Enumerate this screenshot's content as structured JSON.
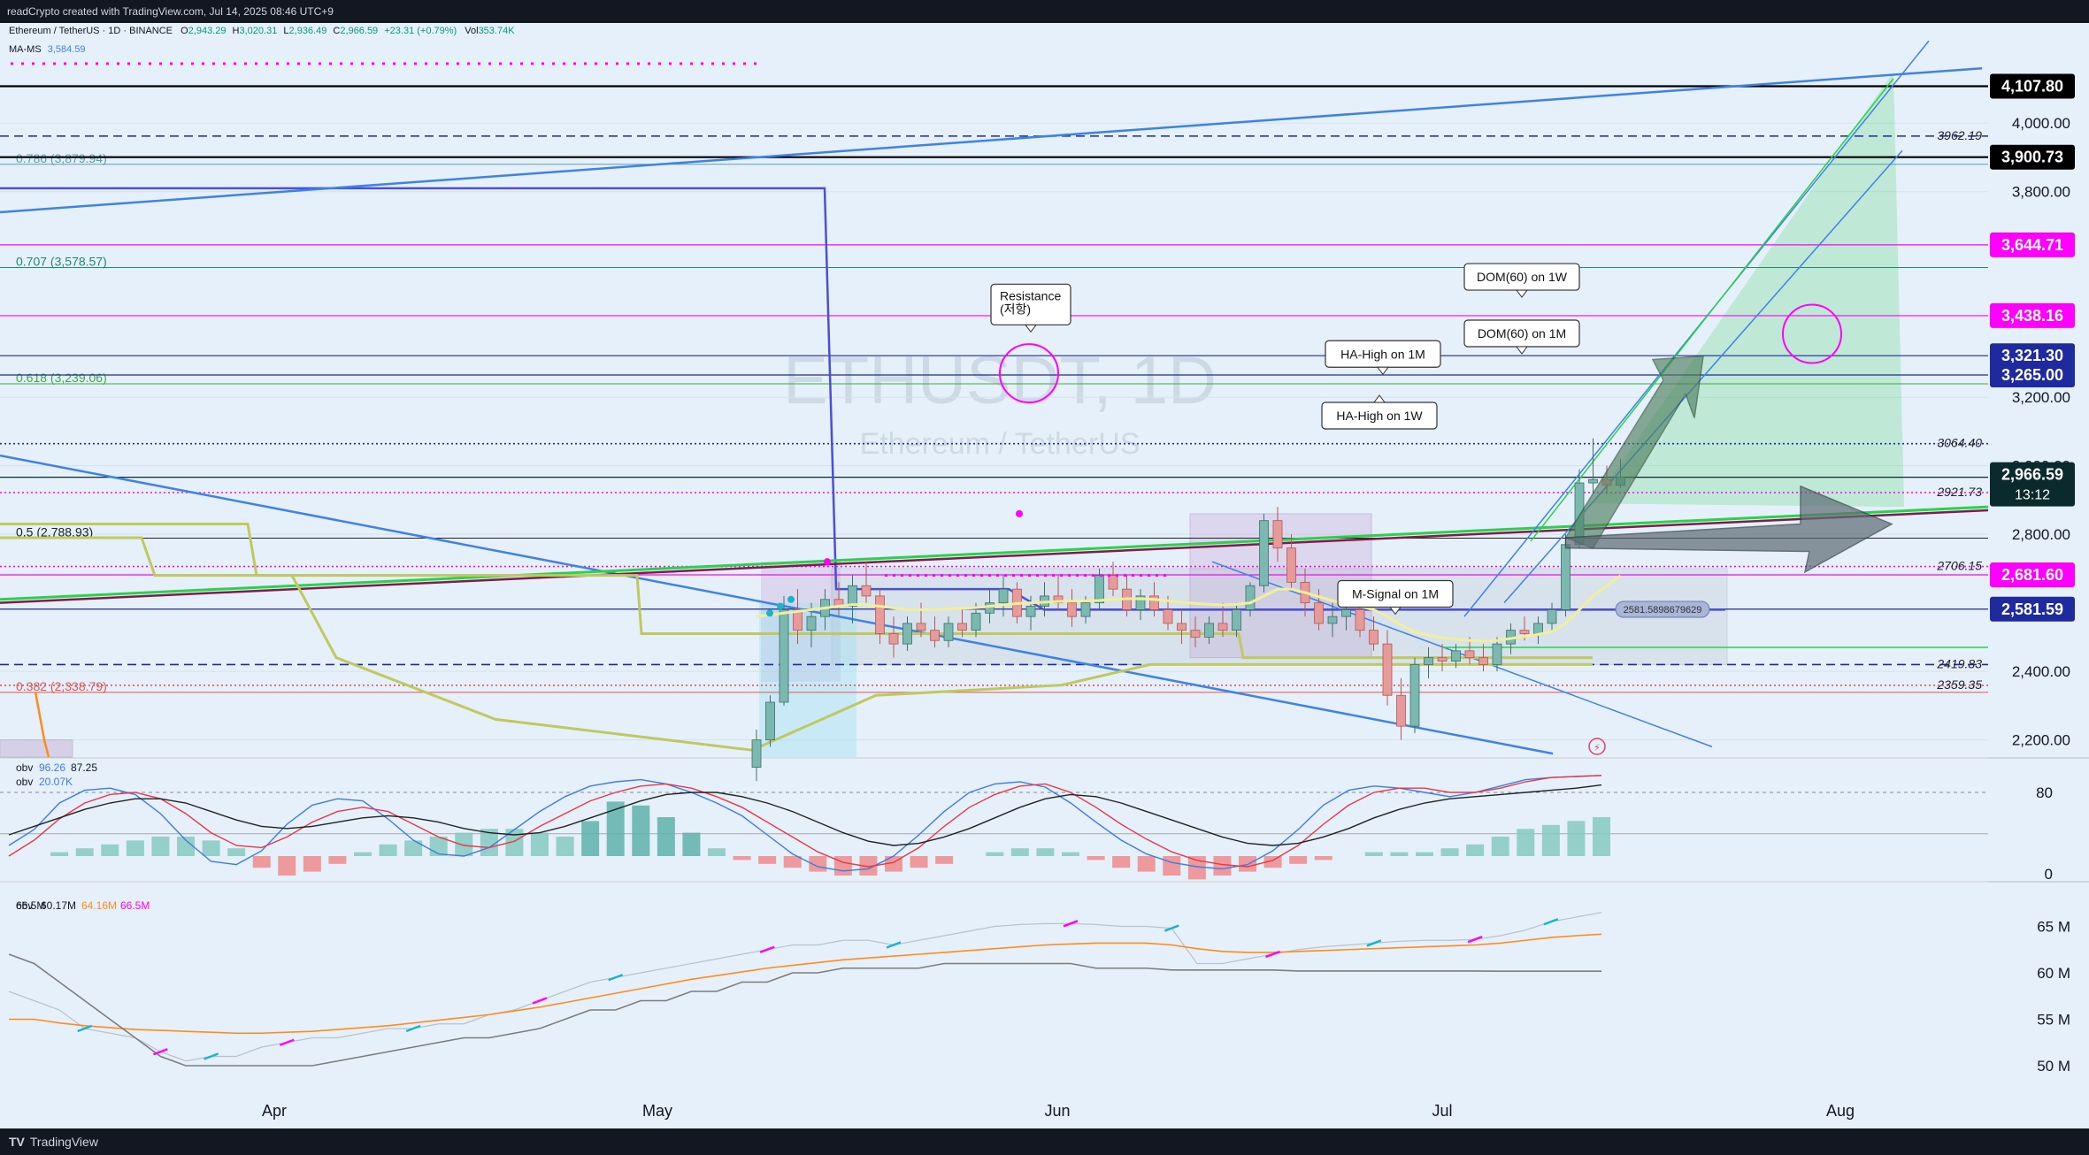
{
  "header": {
    "credit": "readCrypto created with TradingView.com, Jul 14, 2025 08:46 UTC+9"
  },
  "legend": {
    "symbol_line": "Ethereum / TetherUS · 1D · BINANCE",
    "open_label": "O",
    "open": "2,943.29",
    "high_label": "H",
    "high": "3,020.31",
    "low_label": "L",
    "low": "2,936.49",
    "close_label": "C",
    "close": "2,966.59",
    "change": "+23.31 (+0.79%)",
    "vol_label": "Vol",
    "volume": "353.74K",
    "ma_line_prefix": "MA-MS",
    "ma_line_value": "3,584.59"
  },
  "watermark": {
    "symbol": "ETHUSDT, 1D",
    "name": "Ethereum / TetherUS"
  },
  "colors": {
    "background": "#e5f0fa",
    "up_candle": "#7ab8b0",
    "down_candle": "#e69a9a",
    "blue_line": "#3f82e6",
    "navy_line": "#1f2a9e",
    "magenta": "#ff00ff",
    "green_line": "#2bd14a",
    "olive": "#c0c860",
    "fib_text": "#5a9fb3",
    "price_tag": "#0b2a2e"
  },
  "chart_data": [
    {
      "type": "line",
      "title": "ETHUSDT, 1D",
      "subtitle": "Ethereum / TetherUS",
      "x_axis": {
        "ticks": [
          "Apr",
          "May",
          "Jun",
          "Jul",
          "Aug"
        ]
      },
      "y_axis": {
        "range": [
          2150,
          4220
        ],
        "ticks": [
          "2,200.00",
          "2,400.00",
          "2,800.00",
          "3,000.00",
          "3,200.00",
          "3,800.00",
          "4,000.00"
        ]
      },
      "price_tags": [
        {
          "label": "4,107.80",
          "price": 4107.8,
          "style": "black"
        },
        {
          "label": "3,900.73",
          "price": 3900.73,
          "style": "black"
        },
        {
          "label": "3,644.71",
          "price": 3644.71,
          "style": "magenta"
        },
        {
          "label": "3,438.16",
          "price": 3438.16,
          "style": "magenta"
        },
        {
          "label": "3,321.30",
          "price": 3321.3,
          "style": "navy"
        },
        {
          "label": "3,265.00",
          "price": 3265.0,
          "style": "navy"
        },
        {
          "label": "2,966.59",
          "sublabel": "13:12",
          "price": 2966.59,
          "style": "dark"
        },
        {
          "label": "2,681.60",
          "price": 2681.6,
          "style": "magenta"
        },
        {
          "label": "2,581.59",
          "price": 2581.59,
          "style": "navy"
        }
      ],
      "level_labels": [
        {
          "label": "3962.19",
          "price": 3962.19
        },
        {
          "label": "3064.40",
          "price": 3064.4
        },
        {
          "label": "2921.73",
          "price": 2921.73
        },
        {
          "label": "2706.15",
          "price": 2706.15
        },
        {
          "label": "2419.83",
          "price": 2419.83
        },
        {
          "label": "2359.35",
          "price": 2359.35
        }
      ],
      "fib_levels": [
        {
          "label": "0.786 (3,879.94)",
          "price": 3879.94
        },
        {
          "label": "0.707 (3,578.57)",
          "price": 3578.57
        },
        {
          "label": "0.618 (3,239.06)",
          "price": 3239.06
        },
        {
          "label": "0.5 (2,788.93)",
          "price": 2788.93
        },
        {
          "label": "0.382 (2,338.79)",
          "price": 2338.79
        }
      ],
      "callouts": [
        {
          "text": "Resistance\n(저항)"
        },
        {
          "text": "DOM(60) on 1W"
        },
        {
          "text": "DOM(60) on 1M"
        },
        {
          "text": "HA-High on 1M"
        },
        {
          "text": "HA-High on 1W"
        },
        {
          "text": "M-Signal on 1M"
        }
      ],
      "box_label": "2581.5898679629",
      "candles": [
        [
          2120,
          2230,
          2080,
          2200
        ],
        [
          2200,
          2330,
          2180,
          2310
        ],
        [
          2310,
          2620,
          2300,
          2580
        ],
        [
          2580,
          2640,
          2480,
          2520
        ],
        [
          2520,
          2600,
          2470,
          2560
        ],
        [
          2560,
          2640,
          2520,
          2610
        ],
        [
          2610,
          2660,
          2560,
          2590
        ],
        [
          2590,
          2680,
          2540,
          2650
        ],
        [
          2650,
          2720,
          2600,
          2620
        ],
        [
          2620,
          2640,
          2480,
          2510
        ],
        [
          2510,
          2560,
          2440,
          2480
        ],
        [
          2480,
          2560,
          2460,
          2540
        ],
        [
          2540,
          2600,
          2500,
          2520
        ],
        [
          2520,
          2560,
          2470,
          2490
        ],
        [
          2490,
          2560,
          2470,
          2540
        ],
        [
          2540,
          2580,
          2500,
          2520
        ],
        [
          2520,
          2600,
          2500,
          2570
        ],
        [
          2570,
          2640,
          2540,
          2600
        ],
        [
          2600,
          2680,
          2560,
          2640
        ],
        [
          2640,
          2660,
          2540,
          2560
        ],
        [
          2560,
          2620,
          2520,
          2590
        ],
        [
          2590,
          2660,
          2560,
          2620
        ],
        [
          2620,
          2680,
          2580,
          2600
        ],
        [
          2600,
          2640,
          2530,
          2560
        ],
        [
          2560,
          2620,
          2540,
          2600
        ],
        [
          2600,
          2700,
          2580,
          2680
        ],
        [
          2680,
          2720,
          2620,
          2640
        ],
        [
          2640,
          2680,
          2560,
          2580
        ],
        [
          2580,
          2640,
          2550,
          2620
        ],
        [
          2620,
          2660,
          2560,
          2580
        ],
        [
          2580,
          2620,
          2520,
          2540
        ],
        [
          2540,
          2580,
          2480,
          2520
        ],
        [
          2520,
          2560,
          2470,
          2500
        ],
        [
          2500,
          2560,
          2480,
          2540
        ],
        [
          2540,
          2600,
          2500,
          2520
        ],
        [
          2520,
          2600,
          2500,
          2580
        ],
        [
          2580,
          2660,
          2560,
          2650
        ],
        [
          2650,
          2860,
          2630,
          2840
        ],
        [
          2840,
          2880,
          2720,
          2760
        ],
        [
          2760,
          2800,
          2640,
          2660
        ],
        [
          2660,
          2700,
          2560,
          2600
        ],
        [
          2600,
          2640,
          2520,
          2540
        ],
        [
          2540,
          2600,
          2500,
          2560
        ],
        [
          2560,
          2620,
          2520,
          2580
        ],
        [
          2580,
          2620,
          2500,
          2520
        ],
        [
          2520,
          2560,
          2460,
          2480
        ],
        [
          2480,
          2520,
          2300,
          2330
        ],
        [
          2330,
          2380,
          2200,
          2240
        ],
        [
          2240,
          2440,
          2220,
          2420
        ],
        [
          2420,
          2470,
          2380,
          2440
        ],
        [
          2440,
          2480,
          2400,
          2430
        ],
        [
          2430,
          2480,
          2410,
          2460
        ],
        [
          2460,
          2500,
          2420,
          2440
        ],
        [
          2440,
          2480,
          2400,
          2420
        ],
        [
          2420,
          2500,
          2400,
          2480
        ],
        [
          2480,
          2540,
          2450,
          2520
        ],
        [
          2520,
          2560,
          2490,
          2510
        ],
        [
          2510,
          2560,
          2480,
          2540
        ],
        [
          2540,
          2600,
          2520,
          2580
        ],
        [
          2580,
          2800,
          2560,
          2770
        ],
        [
          2770,
          2990,
          2760,
          2950
        ],
        [
          2950,
          3080,
          2920,
          2960
        ],
        [
          2960,
          3000,
          2920,
          2943
        ],
        [
          2943,
          3020,
          2936,
          2967
        ]
      ],
      "series": [
        {
          "name": "M-Signal on 1D",
          "color": "#f7f5c0",
          "values": [
            2560,
            2565,
            2570,
            2575,
            2580,
            2585,
            2590,
            2595,
            2595,
            2590,
            2585,
            2580,
            2580,
            2580,
            2582,
            2584,
            2586,
            2590,
            2594,
            2598,
            2600,
            2602,
            2604,
            2605,
            2606,
            2607,
            2610,
            2612,
            2612,
            2610,
            2606,
            2602,
            2598,
            2596,
            2594,
            2596,
            2600,
            2620,
            2640,
            2640,
            2630,
            2618,
            2606,
            2598,
            2590,
            2580,
            2560,
            2535,
            2515,
            2505,
            2498,
            2494,
            2490,
            2488,
            2490,
            2496,
            2502,
            2508,
            2516,
            2540,
            2580,
            2620,
            2650,
            2680
          ]
        }
      ]
    },
    {
      "type": "line",
      "title": "obv",
      "legend": [
        {
          "name": "obv",
          "value": "96.26"
        },
        {
          "name": "",
          "value": "87.25"
        },
        {
          "name": "obv",
          "value": "20.07K"
        }
      ],
      "y_axis": {
        "ticks": [
          "80",
          "0"
        ]
      },
      "series": [
        {
          "name": "obv",
          "color": "#3f7be6",
          "values": [
            30,
            45,
            70,
            82,
            84,
            78,
            60,
            35,
            15,
            12,
            25,
            50,
            68,
            74,
            72,
            55,
            35,
            22,
            20,
            28,
            45,
            62,
            76,
            86,
            90,
            92,
            88,
            80,
            70,
            58,
            40,
            22,
            10,
            6,
            8,
            20,
            40,
            62,
            80,
            88,
            90,
            85,
            70,
            52,
            35,
            22,
            14,
            10,
            8,
            12,
            25,
            45,
            68,
            82,
            86,
            84,
            80,
            76,
            80,
            86,
            92,
            94,
            95,
            96
          ]
        },
        {
          "name": "",
          "color": "#e63946",
          "values": [
            20,
            35,
            55,
            70,
            78,
            80,
            74,
            60,
            42,
            30,
            28,
            38,
            52,
            62,
            66,
            62,
            50,
            38,
            30,
            28,
            34,
            48,
            60,
            72,
            80,
            86,
            88,
            84,
            76,
            66,
            52,
            38,
            24,
            14,
            10,
            14,
            28,
            48,
            66,
            78,
            86,
            88,
            80,
            66,
            50,
            36,
            24,
            16,
            12,
            10,
            16,
            30,
            50,
            68,
            80,
            84,
            84,
            80,
            80,
            84,
            90,
            94,
            95,
            96
          ]
        },
        {
          "name": "",
          "color": "#222222",
          "values": [
            40,
            48,
            56,
            64,
            70,
            74,
            74,
            70,
            62,
            54,
            48,
            46,
            48,
            52,
            56,
            58,
            56,
            52,
            46,
            42,
            40,
            42,
            48,
            56,
            64,
            72,
            78,
            80,
            80,
            76,
            70,
            62,
            52,
            42,
            34,
            30,
            32,
            38,
            46,
            56,
            66,
            74,
            78,
            76,
            70,
            62,
            54,
            46,
            38,
            32,
            30,
            32,
            38,
            46,
            56,
            64,
            70,
            74,
            76,
            78,
            80,
            82,
            84,
            87
          ]
        }
      ],
      "histogram": [
        0,
        0,
        2,
        4,
        6,
        8,
        10,
        10,
        8,
        4,
        -6,
        -10,
        -8,
        -4,
        2,
        6,
        8,
        10,
        12,
        14,
        14,
        12,
        10,
        18,
        28,
        26,
        20,
        12,
        4,
        -2,
        -4,
        -6,
        -8,
        -10,
        -10,
        -8,
        -6,
        -4,
        0,
        2,
        4,
        4,
        2,
        -2,
        -6,
        -8,
        -10,
        -12,
        -10,
        -8,
        -6,
        -4,
        -2,
        0,
        2,
        2,
        2,
        4,
        6,
        10,
        14,
        16,
        18,
        20
      ]
    },
    {
      "type": "line",
      "title": "obv",
      "legend": [
        {
          "name": "obv",
          "value": "66.5M"
        },
        {
          "name": "",
          "value": "60.17M"
        },
        {
          "name": "",
          "value": "64.16M"
        },
        {
          "name": "",
          "value": "66.5M"
        }
      ],
      "y_axis": {
        "range": [
          48,
          68
        ],
        "ticks": [
          "65 M",
          "60 M",
          "55 M",
          "50 M"
        ]
      },
      "series": [
        {
          "name": "",
          "color": "#b9c2cf",
          "values": [
            58,
            57,
            56,
            54,
            53.5,
            53,
            51.5,
            50.5,
            51,
            51,
            52,
            52.5,
            53,
            53,
            53.5,
            54,
            54,
            54.5,
            54.5,
            55.5,
            56,
            57,
            58,
            59,
            59.5,
            60,
            60.5,
            61,
            61.5,
            62,
            62.5,
            63,
            63,
            63.5,
            63.5,
            63,
            63.5,
            64,
            64.5,
            65,
            65.2,
            65.3,
            65.3,
            65.2,
            65,
            65,
            64.8,
            61,
            61,
            61.5,
            62,
            62.5,
            62.8,
            63,
            63.2,
            63.4,
            63.5,
            63.5,
            63.6,
            64,
            64.6,
            65.5,
            66,
            66.5
          ]
        },
        {
          "name": "",
          "color": "#ff8c1a",
          "values": [
            55,
            55,
            54.6,
            54.3,
            54.1,
            53.9,
            53.8,
            53.7,
            53.6,
            53.5,
            53.5,
            53.6,
            53.7,
            53.9,
            54.1,
            54.3,
            54.6,
            54.9,
            55.2,
            55.5,
            55.9,
            56.3,
            56.8,
            57.3,
            57.8,
            58.3,
            58.8,
            59.3,
            59.7,
            60.1,
            60.5,
            60.8,
            61.1,
            61.4,
            61.6,
            61.8,
            62,
            62.2,
            62.4,
            62.6,
            62.8,
            63,
            63.1,
            63.2,
            63.2,
            63.2,
            63,
            62.6,
            62.3,
            62.2,
            62.2,
            62.3,
            62.4,
            62.5,
            62.6,
            62.7,
            62.8,
            62.9,
            63,
            63.2,
            63.5,
            63.8,
            64,
            64.16
          ]
        },
        {
          "name": "",
          "color": "#7d7d7d",
          "values": [
            62,
            61,
            59,
            57,
            55,
            53,
            51,
            50,
            50,
            50,
            50,
            50,
            50,
            50.5,
            51,
            51.5,
            52,
            52.5,
            53,
            53,
            53.5,
            54,
            55,
            56,
            56,
            57,
            57,
            58,
            58,
            59,
            59,
            60,
            60,
            60.5,
            60.5,
            60.5,
            60.5,
            61,
            61,
            61,
            61,
            61,
            61,
            60.5,
            60.5,
            60.5,
            60.3,
            60.3,
            60.3,
            60.3,
            60.3,
            60.2,
            60.2,
            60.2,
            60.2,
            60.2,
            60.2,
            60.2,
            60.2,
            60.17,
            60.17,
            60.17,
            60.17,
            60.17
          ]
        }
      ]
    }
  ]
}
